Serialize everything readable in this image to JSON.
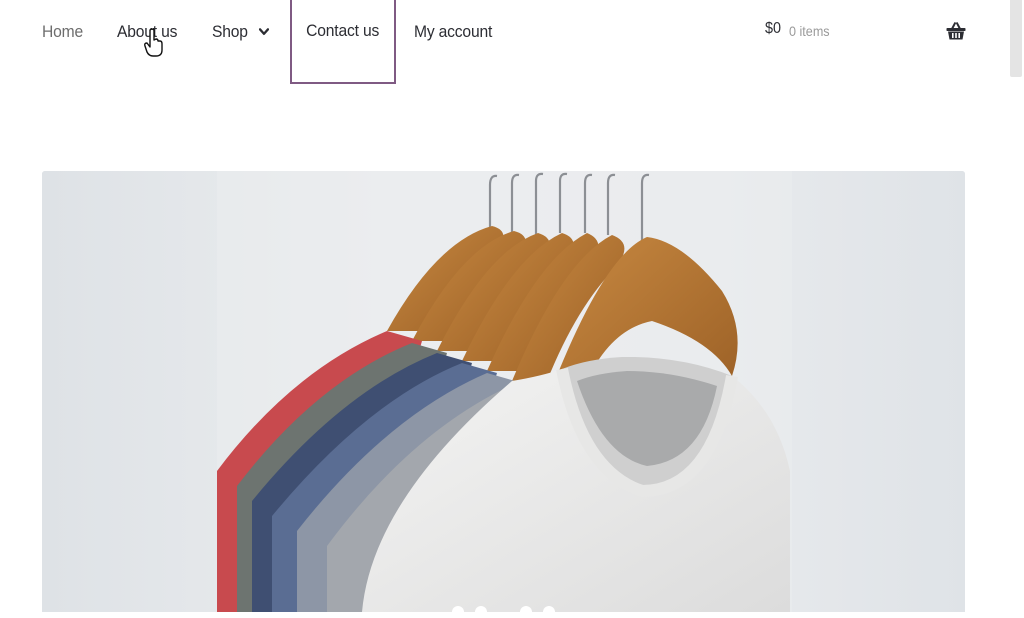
{
  "nav": {
    "items": [
      {
        "label": "Home"
      },
      {
        "label": "About us"
      },
      {
        "label": "Shop"
      },
      {
        "label": "Contact us"
      },
      {
        "label": "My account"
      }
    ]
  },
  "cart": {
    "total": "$0",
    "count": "0 items",
    "icon": "basket-icon"
  },
  "hero": {
    "image": "t-shirts-on-wooden-hangers",
    "slide_count": 4
  },
  "colors": {
    "accent_border": "#7f5a83",
    "text": "#2c2d33",
    "muted": "#9a9a9a"
  }
}
